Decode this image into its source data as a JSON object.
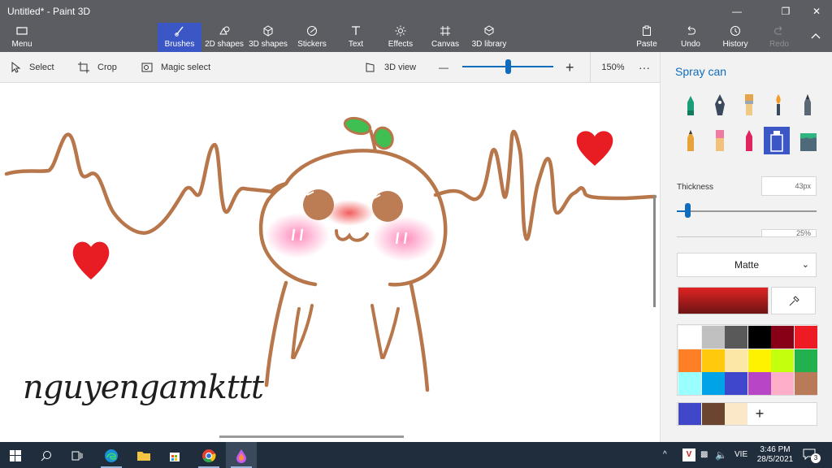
{
  "window": {
    "title": "Untitled* - Paint 3D",
    "minimize": "—",
    "maximize": "❐",
    "close": "✕"
  },
  "ribbon": {
    "menu": "Menu",
    "tools": [
      {
        "label": "Brushes",
        "icon": "brush-icon"
      },
      {
        "label": "2D shapes",
        "icon": "2d-shapes-icon"
      },
      {
        "label": "3D shapes",
        "icon": "3d-shapes-icon"
      },
      {
        "label": "Stickers",
        "icon": "stickers-icon"
      },
      {
        "label": "Text",
        "icon": "text-icon"
      },
      {
        "label": "Effects",
        "icon": "effects-icon"
      },
      {
        "label": "Canvas",
        "icon": "canvas-icon"
      },
      {
        "label": "3D library",
        "icon": "3d-library-icon"
      }
    ],
    "paste": "Paste",
    "undo": "Undo",
    "history": "History",
    "redo": "Redo"
  },
  "toolbar": {
    "select": "Select",
    "crop": "Crop",
    "magic_select": "Magic select",
    "view_3d": "3D view",
    "zoom_minus": "—",
    "zoom_plus": "+",
    "zoom_fraction": 0.5,
    "zoom": "150%",
    "more": "···"
  },
  "canvas": {
    "signature": "nguyengamkttt"
  },
  "panel": {
    "title": "Spray can",
    "brushes": [
      "marker",
      "calligraphy-pen",
      "oil-brush",
      "watercolor",
      "pixel-pen",
      "pencil",
      "eraser",
      "crayon",
      "spray-can",
      "fill"
    ],
    "active_brush": "spray-can",
    "thickness_label": "Thickness",
    "thickness_value": "43px",
    "thickness_fraction": 0.08,
    "opacity_value": "25%",
    "finish": "Matte",
    "current_color": "#e02323",
    "palette": [
      "#ffffff",
      "#c0c0c0",
      "#595959",
      "#000000",
      "#880015",
      "#ed1c24",
      "#ff7f27",
      "#ffc90e",
      "#fde7a6",
      "#fff200",
      "#c4ff0e",
      "#22b14c",
      "#99ffff",
      "#00a2e8",
      "#3f48cc",
      "#b845c6",
      "#ffaec9",
      "#b97a57"
    ],
    "custom_colors": [
      "#4047c9",
      "#6b4530",
      "#fbe8c8"
    ],
    "add_color": "+"
  },
  "taskbar": {
    "time": "3:46 PM",
    "date": "28/5/2021",
    "language": "VIE",
    "notification_count": "3"
  }
}
